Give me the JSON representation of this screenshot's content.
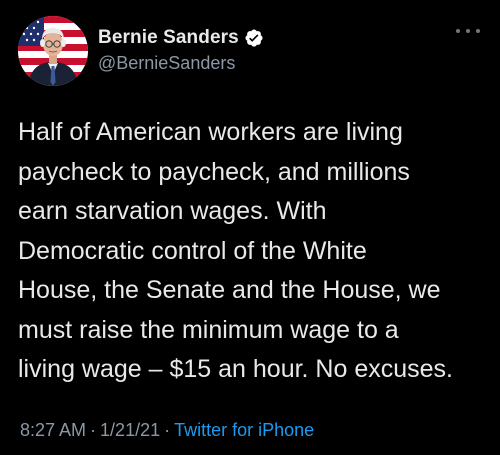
{
  "author": {
    "display_name": "Bernie Sanders",
    "handle": "@BernieSanders",
    "verified_icon": "verified-badge-icon"
  },
  "tweet": {
    "text": "Half of American workers are living\npaycheck to paycheck, and millions\nearn starvation wages. With\nDemocratic control of the White\nHouse, the Senate and the House, we\nmust raise the minimum wage to a\nliving wage – $15 an hour. No excuses."
  },
  "meta": {
    "time": "8:27 AM",
    "separator": "·",
    "date": "1/21/21",
    "source": "Twitter for iPhone"
  },
  "icons": {
    "more": "more-options-icon",
    "avatar": "profile-avatar"
  },
  "colors": {
    "background": "#000000",
    "text_primary": "#e7e9ea",
    "text_secondary": "#8b98a5",
    "link_blue": "#1d9bf0",
    "verified_blue": "#1d9bf0"
  }
}
